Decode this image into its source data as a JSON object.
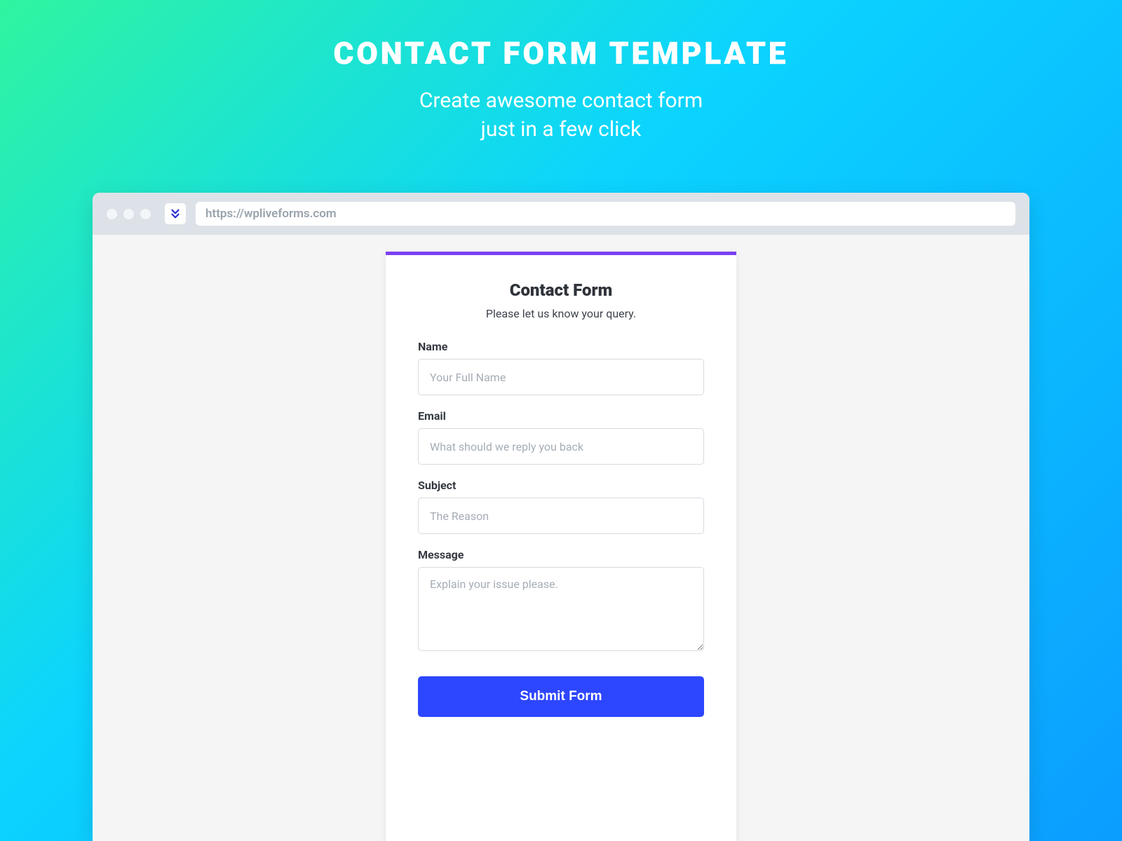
{
  "hero": {
    "title": "CONTACT FORM TEMPLATE",
    "subtitle_line1": "Create awesome contact form",
    "subtitle_line2": "just in a few click"
  },
  "browser": {
    "url": "https://wpliveforms.com"
  },
  "form": {
    "title": "Contact Form",
    "subtitle": "Please let us know your query.",
    "fields": {
      "name": {
        "label": "Name",
        "placeholder": "Your Full Name"
      },
      "email": {
        "label": "Email",
        "placeholder": "What should we reply you back"
      },
      "subject": {
        "label": "Subject",
        "placeholder": "The Reason"
      },
      "message": {
        "label": "Message",
        "placeholder": "Explain your issue please."
      }
    },
    "submit_label": "Submit Form"
  },
  "colors": {
    "accent": "#7c3ff2",
    "primary_button": "#2d46ff"
  }
}
